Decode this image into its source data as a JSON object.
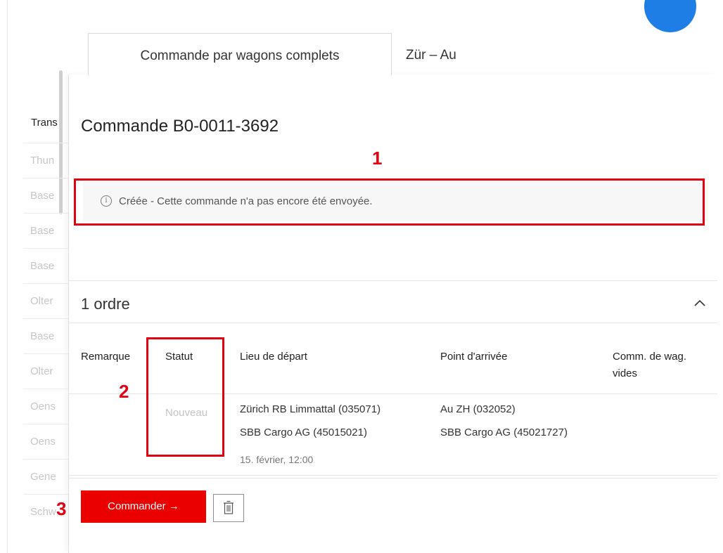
{
  "background_list": {
    "header": "Trans",
    "rows": [
      "Thun",
      "Base",
      "Base",
      "Base",
      "Olter",
      "Base",
      "Olter",
      "Oens",
      "Oens",
      "Gene",
      "Schw"
    ]
  },
  "tabs": [
    {
      "label": "Commande par wagons complets",
      "active": true
    },
    {
      "label": "Zür – Au",
      "active": false
    }
  ],
  "order": {
    "title": "Commande B0-0011-3692",
    "info_message": "Créée - Cette commande n'a pas encore été envoyée.",
    "section_title": "1 ordre",
    "table": {
      "headers": [
        "Remarque",
        "Statut",
        "Lieu de départ",
        "Point d'arrivée",
        "Comm. de wag. vides"
      ],
      "row": {
        "remarque": "",
        "statut": "Nouveau",
        "departure_line1": "Zürich RB Limmattal (035071)",
        "departure_line2": "SBB Cargo AG (45015021)",
        "departure_date": "15. février,  12:00",
        "arrival_line1": "Au ZH (032052)",
        "arrival_line2": "SBB Cargo AG (45021727)",
        "empty_wagons": ""
      }
    },
    "order_button_label": "Commander →"
  },
  "annotations": [
    "1",
    "2",
    "3"
  ],
  "colors": {
    "primary_red": "#eb0000",
    "annotation_red": "#e3000f",
    "bubble_blue": "#1f7de6"
  },
  "icons": [
    "info-icon",
    "chevron-up-icon",
    "trash-icon"
  ]
}
